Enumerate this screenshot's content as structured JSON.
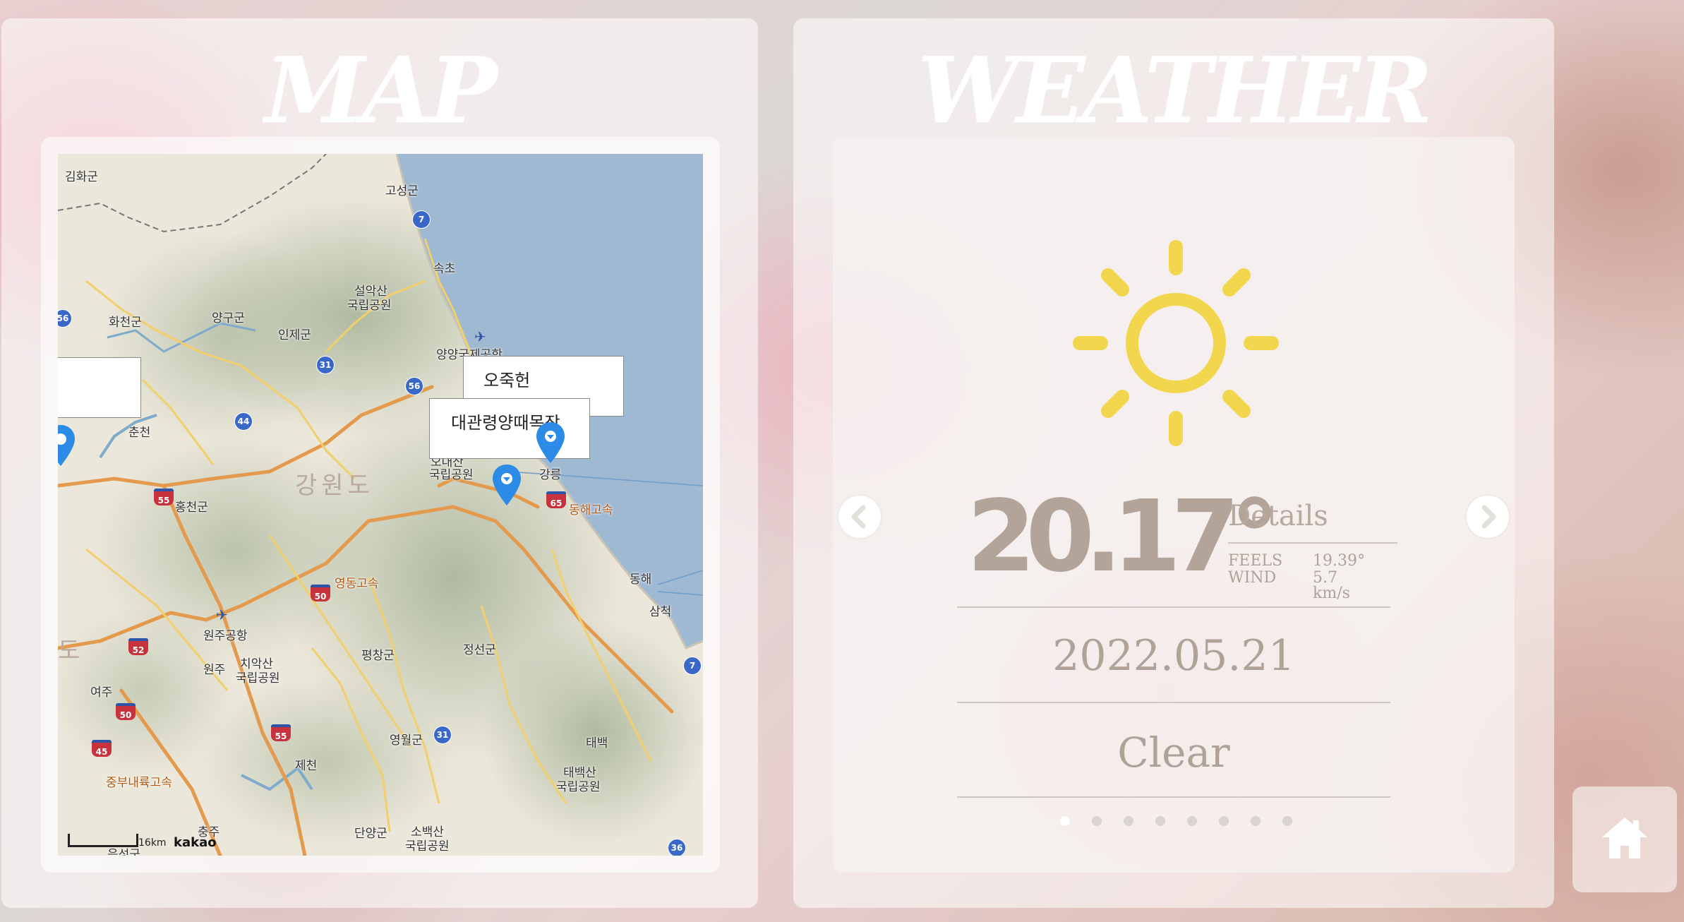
{
  "map_panel": {
    "title": "MAP",
    "labels": {
      "gimhwa": "김화군",
      "goseong": "고성군",
      "sokcho": "속초",
      "seorak": "설악산",
      "seorak2": "국립공원",
      "hwacheon": "화천군",
      "yanggu": "양구군",
      "inje": "인제군",
      "yangyang_airport": "양양국제공항",
      "chuncheon": "춘천",
      "gangwon": "강원도",
      "odaesan": "오대산",
      "odaesan2": "국립공원",
      "gangneung": "강릉",
      "hongcheon": "홍천군",
      "donghae": "동해",
      "samcheok": "삼척",
      "wonju_airport": "원주공항",
      "chiaksan": "치악산",
      "chiaksan2": "국립공원",
      "pyeongchang": "평창군",
      "jeongseon": "정선군",
      "wonju": "원주",
      "yeoju": "여주",
      "yeongwol": "영월군",
      "taebaek": "태백",
      "taebaeksan": "태백산",
      "taebaeksan2": "국립공원",
      "jecheon": "제천",
      "chungju": "충주",
      "danyang": "단양군",
      "sobaeksan": "소백산",
      "sobaeksan2": "국립공원",
      "eumseong": "음성군",
      "yeongdong_exp": "영동고속",
      "donghae_exp": "동해고속",
      "jungbu_exp": "중부내륙고속",
      "do": "도"
    },
    "route_badges": {
      "r7a": "7",
      "r7b": "7",
      "r31a": "31",
      "r31b": "31",
      "r44": "44",
      "r56a": "56",
      "r56b": "56",
      "r36": "36"
    },
    "highway_badges": {
      "h55a": "55",
      "h55b": "55",
      "h65": "65",
      "h50a": "50",
      "h50b": "50",
      "h52": "52",
      "h45": "45"
    },
    "markers": {
      "ojukheon": "오죽헌",
      "daegwallyeong": "대관령양때목장",
      "left_partial": ""
    },
    "scale": "16km",
    "provider": "kakao"
  },
  "weather_panel": {
    "title": "WEATHER",
    "icon": "sun-icon",
    "temperature": "20.17°",
    "details_title": "Details",
    "feels_label": "FEELS",
    "feels_value": "19.39°",
    "wind_label": "WIND",
    "wind_value": "5.7 km/s",
    "date": "2022.05.21",
    "condition": "Clear",
    "slide_count": 8,
    "active_slide": 1
  },
  "colors": {
    "sun": "#f2d74e",
    "text_muted": "#b0a298",
    "pin": "#2b8be6"
  }
}
